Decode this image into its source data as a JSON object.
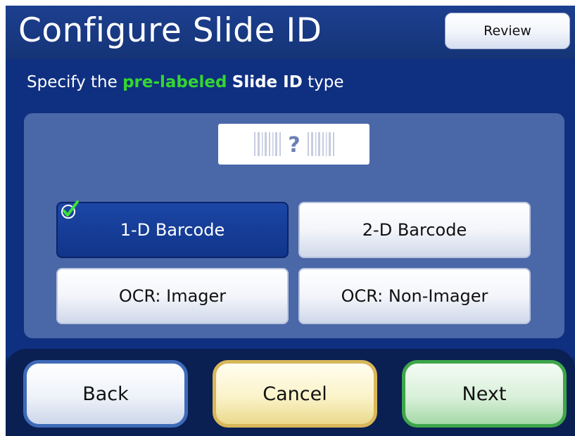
{
  "header": {
    "title": "Configure Slide ID",
    "review_label": "Review"
  },
  "instruction": {
    "prefix": "Specify the ",
    "highlight": "pre-labeled",
    "middle": " ",
    "bold": "Slide ID",
    "suffix": " type",
    "highlight_color": "#35d631"
  },
  "slide_label": {
    "icon": "barcode-question-icon",
    "glyph": "?"
  },
  "options": [
    {
      "label": "1-D Barcode",
      "selected": true
    },
    {
      "label": "2-D Barcode",
      "selected": false
    },
    {
      "label": "OCR: Imager",
      "selected": false
    },
    {
      "label": "OCR: Non-Imager",
      "selected": false
    }
  ],
  "footer": {
    "back_label": "Back",
    "cancel_label": "Cancel",
    "next_label": "Next"
  },
  "colors": {
    "background": "#0d2a6b",
    "panel": "#4a67a8",
    "selected_option": "#173f9a",
    "back_border": "#3e6ab8",
    "cancel_border": "#d8b75a",
    "next_border": "#3ea64a"
  }
}
